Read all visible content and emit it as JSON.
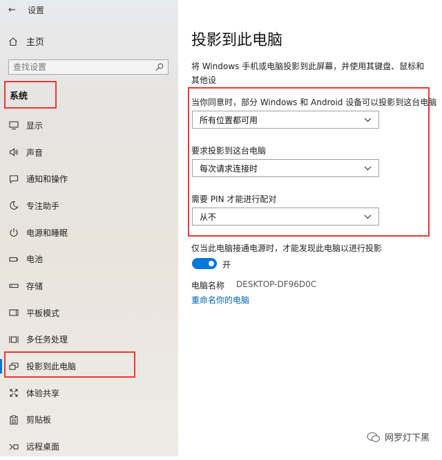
{
  "window": {
    "title": "设置"
  },
  "sidebar": {
    "home_label": "主页",
    "search_placeholder": "查找设置",
    "section_title": "系统",
    "items": [
      {
        "label": "显示",
        "icon": "monitor-icon"
      },
      {
        "label": "声音",
        "icon": "speaker-icon"
      },
      {
        "label": "通知和操作",
        "icon": "notification-icon"
      },
      {
        "label": "专注助手",
        "icon": "moon-icon"
      },
      {
        "label": "电源和睡眠",
        "icon": "power-icon"
      },
      {
        "label": "电池",
        "icon": "battery-icon"
      },
      {
        "label": "存储",
        "icon": "storage-icon"
      },
      {
        "label": "平板模式",
        "icon": "tablet-icon"
      },
      {
        "label": "多任务处理",
        "icon": "multitasking-icon"
      },
      {
        "label": "投影到此电脑",
        "icon": "project-icon",
        "active": true
      },
      {
        "label": "体验共享",
        "icon": "share-icon"
      },
      {
        "label": "剪贴板",
        "icon": "clipboard-icon"
      },
      {
        "label": "远程桌面",
        "icon": "remote-desktop-icon"
      }
    ]
  },
  "main": {
    "title": "投影到此电脑",
    "description": "将 Windows 手机或电脑投影到此屏幕，并使用其键盘、鼠标和其他设",
    "settings": [
      {
        "label": "当你同意时，部分 Windows 和 Android 设备可以投影到这台电脑",
        "value": "所有位置都可用"
      },
      {
        "label": "要求投影到这台电脑",
        "value": "每次请求连接时"
      },
      {
        "label": "需要 PIN 才能进行配对",
        "value": "从不"
      }
    ],
    "toggle_label": "仅当此电脑接通电源时，才能发现此电脑以进行投影",
    "toggle_state": "开",
    "pc_name_label": "电脑名称",
    "pc_name_value": "DESKTOP-DF96D0C",
    "rename_link": "重命名你的电脑"
  },
  "watermark": "网罗灯下黑",
  "colors": {
    "accent": "#0078d7",
    "highlight_red": "#e53935",
    "link": "#0063b1"
  }
}
